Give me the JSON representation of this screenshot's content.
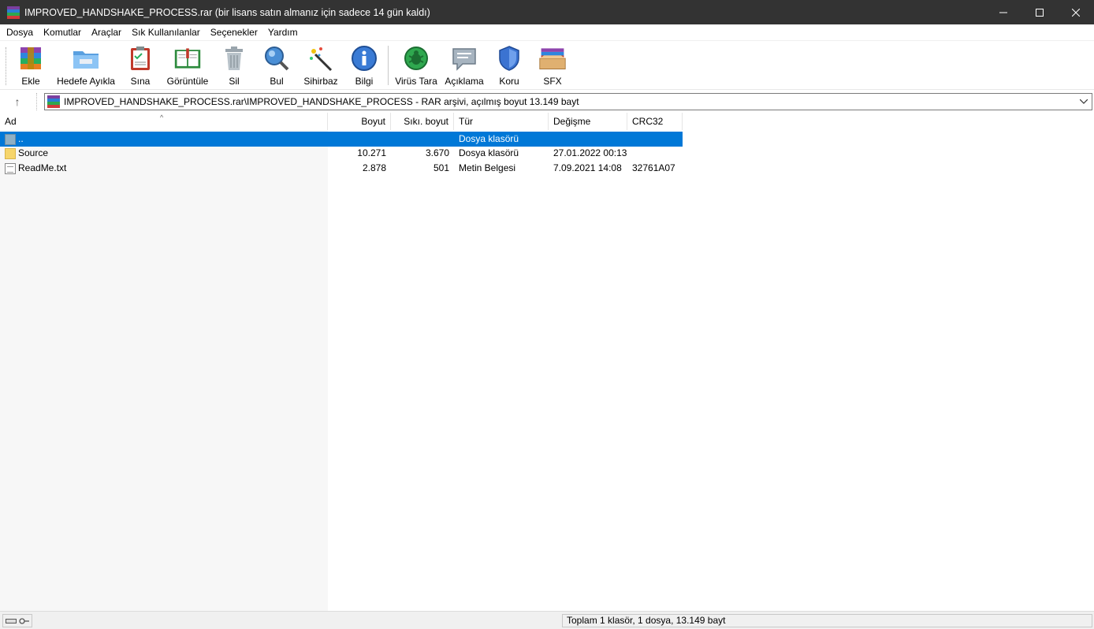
{
  "window": {
    "title": "IMPROVED_HANDSHAKE_PROCESS.rar (bir lisans satın almanız için sadece 14 gün kaldı)",
    "controls": {
      "minimize": "—",
      "maximize": "☐",
      "close": "✕"
    }
  },
  "menu": {
    "items": [
      {
        "label": "Dosya"
      },
      {
        "label": "Komutlar"
      },
      {
        "label": "Araçlar"
      },
      {
        "label": "Sık Kullanılanlar"
      },
      {
        "label": "Seçenekler"
      },
      {
        "label": "Yardım"
      }
    ]
  },
  "toolbar": {
    "buttons": [
      {
        "label": "Ekle",
        "icon": "add-archive-icon"
      },
      {
        "label": "Hedefe Ayıkla",
        "icon": "extract-folder-icon"
      },
      {
        "label": "Sına",
        "icon": "test-checklist-icon"
      },
      {
        "label": "Görüntüle",
        "icon": "view-book-icon"
      },
      {
        "label": "Sil",
        "icon": "trash-icon"
      },
      {
        "label": "Bul",
        "icon": "magnifier-icon"
      },
      {
        "label": "Sihirbaz",
        "icon": "wizard-wand-icon"
      },
      {
        "label": "Bilgi",
        "icon": "info-icon"
      },
      {
        "label": "Virüs Tara",
        "icon": "virus-scan-icon"
      },
      {
        "label": "Açıklama",
        "icon": "comment-icon"
      },
      {
        "label": "Koru",
        "icon": "shield-icon"
      },
      {
        "label": "SFX",
        "icon": "sfx-box-icon"
      }
    ]
  },
  "address": {
    "up_icon": "↑",
    "path": "IMPROVED_HANDSHAKE_PROCESS.rar\\IMPROVED_HANDSHAKE_PROCESS - RAR arşivi, açılmış boyut 13.149 bayt",
    "dropdown_icon": "chevron-down-icon"
  },
  "columns": {
    "name": "Ad",
    "size": "Boyut",
    "packed": "Sıkı. boyut",
    "type": "Tür",
    "modified": "Değişme",
    "crc": "CRC32",
    "sort_caret": "^"
  },
  "files": [
    {
      "name": "..",
      "size": "",
      "packed": "",
      "type": "Dosya klasörü",
      "modified": "",
      "crc": "",
      "selected": true,
      "icon": "folder-up-icon"
    },
    {
      "name": "Source",
      "size": "10.271",
      "packed": "3.670",
      "type": "Dosya klasörü",
      "modified": "27.01.2022 00:13",
      "crc": "",
      "selected": false,
      "icon": "folder-icon"
    },
    {
      "name": "ReadMe.txt",
      "size": "2.878",
      "packed": "501",
      "type": "Metin Belgesi",
      "modified": "7.09.2021 14:08",
      "crc": "32761A07",
      "selected": false,
      "icon": "text-file-icon"
    }
  ],
  "status": {
    "summary": "Toplam 1 klasör, 1 dosya, 13.149 bayt"
  },
  "colors": {
    "titlebar": "#333333",
    "selection": "#0078d7"
  }
}
